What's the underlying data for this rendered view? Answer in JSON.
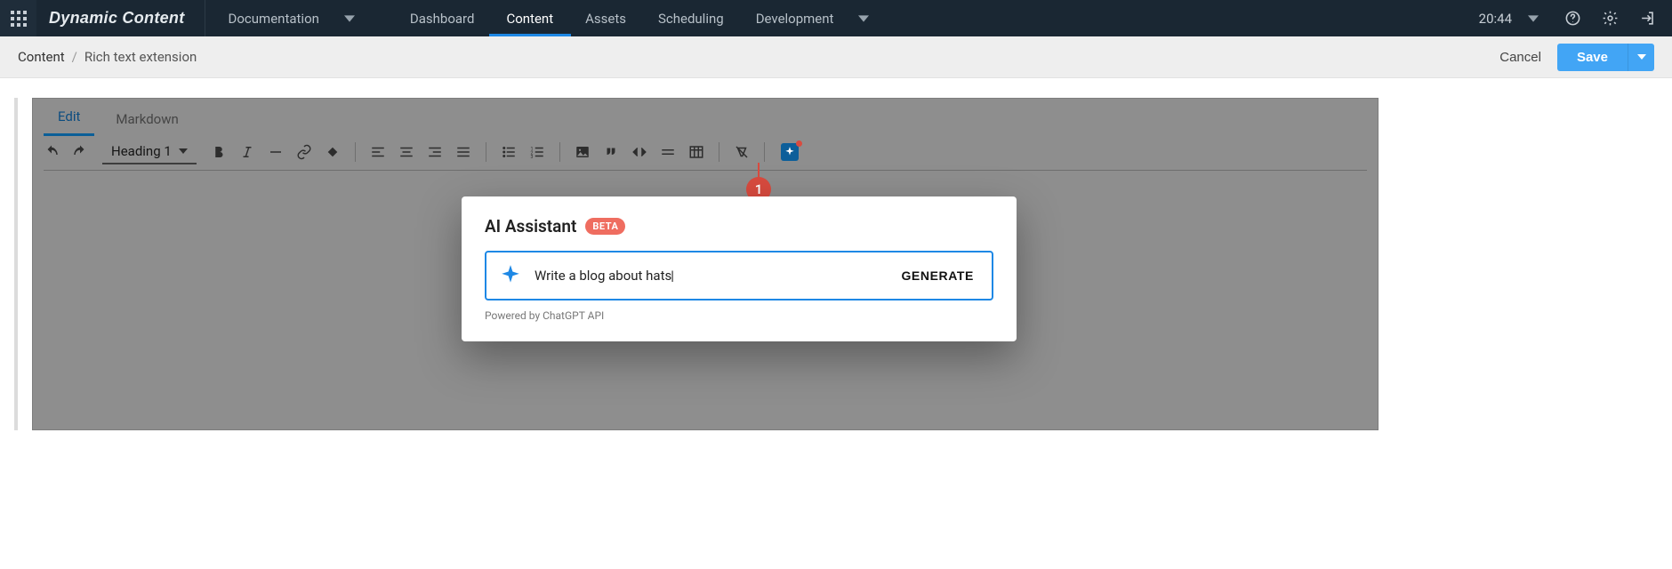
{
  "brand": "Dynamic Content",
  "topnav": {
    "documentation": "Documentation",
    "dashboard": "Dashboard",
    "content": "Content",
    "assets": "Assets",
    "scheduling": "Scheduling",
    "development": "Development"
  },
  "time": "20:44",
  "breadcrumb": {
    "root": "Content",
    "page": "Rich text extension"
  },
  "actions": {
    "cancel": "Cancel",
    "save": "Save"
  },
  "editor": {
    "tabs": {
      "edit": "Edit",
      "markdown": "Markdown"
    },
    "format_selected": "Heading 1",
    "callout_number": "1"
  },
  "modal": {
    "title": "AI Assistant",
    "badge": "BETA",
    "prompt_value": "Write a blog about hats",
    "generate": "GENERATE",
    "powered": "Powered by ChatGPT API"
  }
}
